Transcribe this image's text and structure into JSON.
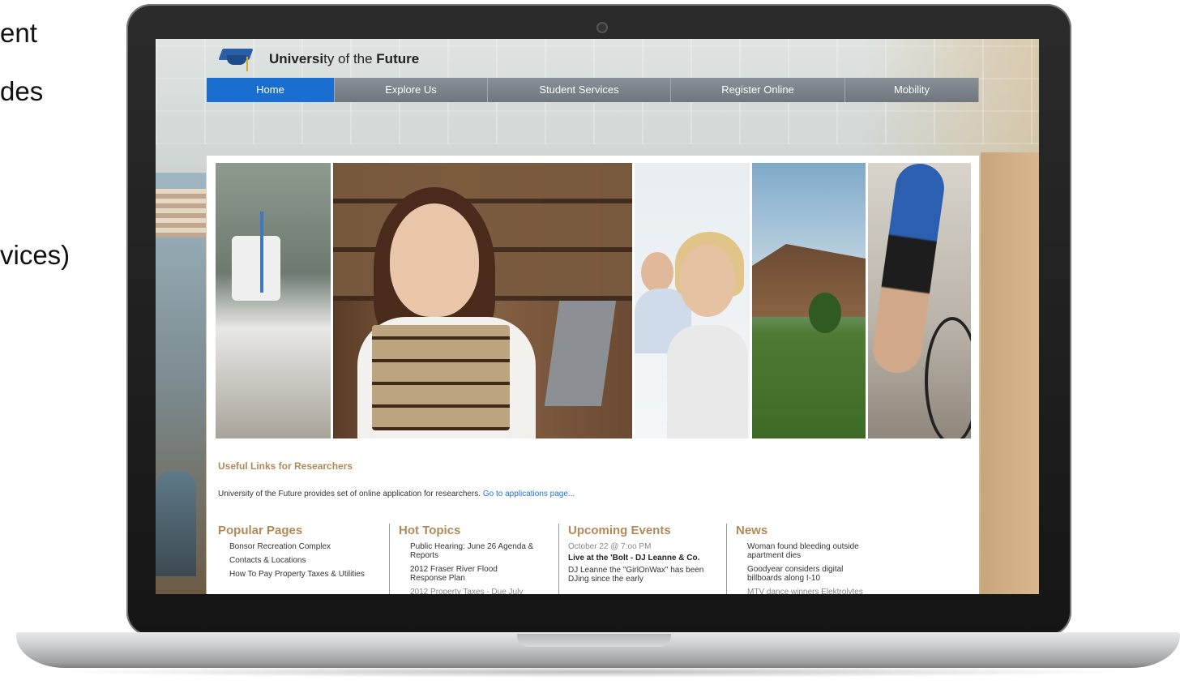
{
  "slide": {
    "fragments": [
      "ent",
      "des",
      "vices)"
    ]
  },
  "site": {
    "logo": {
      "bold1": "Universi",
      "mid": "ty of the ",
      "bold2": "Future",
      "icon": "graduation-cap-icon"
    },
    "nav": [
      {
        "label": "Home",
        "active": true
      },
      {
        "label": "Explore Us",
        "active": false
      },
      {
        "label": "Student Services",
        "active": false
      },
      {
        "label": "Register Online",
        "active": false
      },
      {
        "label": "Mobility",
        "active": false
      }
    ],
    "useful": {
      "title": "Useful Links for Researchers",
      "text": "University of the Future provides set of online application for researchers.",
      "link": "Go to applications page..."
    },
    "columns": {
      "popular": {
        "title": "Popular Pages",
        "items": [
          "Bonsor Recreation Complex",
          "Contacts & Locations",
          "How To Pay Property Taxes & Utilities"
        ]
      },
      "hot": {
        "title": "Hot Topics",
        "items": [
          "Public Hearing: June 26 Agenda & Reports",
          "2012 Fraser River Flood Response Plan",
          "2012 Property Taxes - Due July"
        ]
      },
      "events": {
        "title": "Upcoming Events",
        "date": "October 22 @ 7:oo PM",
        "event_title": "Live at the 'Bolt - DJ Leanne & Co.",
        "desc": "DJ Leanne the \"GirlOnWax\" has been DJing since the early"
      },
      "news": {
        "title": "News",
        "items": [
          "Woman found bleeding outside apartment dies",
          "Goodyear considers digital billboards along I-10",
          "MTV dance winners Elektrolytes"
        ]
      }
    }
  },
  "colors": {
    "nav_active": "#1a6ed0",
    "nav": "#7d848a",
    "heading": "#b28a58",
    "link": "#1a73d6"
  }
}
